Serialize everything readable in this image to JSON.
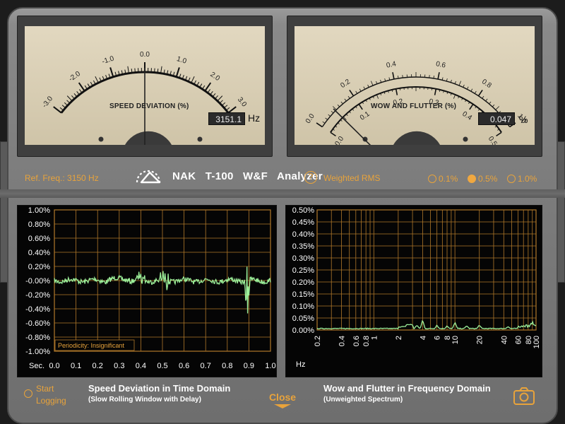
{
  "meters": {
    "speed": {
      "title": "SPEED DEVIATION (%)",
      "scale": [
        "-3.0",
        "-2.0",
        "-1.0",
        "0.0",
        "1.0",
        "2.0",
        "3.0"
      ],
      "readout": "3151.1",
      "unit": "Hz",
      "needle_value": 0.0
    },
    "wow": {
      "title": "WOW AND FLUTTER (%)",
      "outer_scale": [
        "0.0",
        "0.2",
        "0.4",
        "0.6",
        "0.8",
        "1.0"
      ],
      "inner_scale": [
        "0.0",
        "0.1",
        "0.2",
        "0.3",
        "0.4",
        "0.5"
      ],
      "readout": "0.047",
      "unit": "%",
      "needle_value": 0.047
    }
  },
  "band": {
    "ref_freq": "Ref. Freq.: 3150 Hz",
    "brand": "NAK   T-100   W&F   Analyzer",
    "help": "?",
    "weighted": "Weighted RMS",
    "ranges": [
      {
        "label": "0.1%",
        "selected": false
      },
      {
        "label": "0.5%",
        "selected": true
      },
      {
        "label": "1.0%",
        "selected": false
      }
    ]
  },
  "time_plot": {
    "y_ticks": [
      "1.00%",
      "0.80%",
      "0.60%",
      "0.40%",
      "0.20%",
      "-0.00%",
      "-0.20%",
      "-0.40%",
      "-0.60%",
      "-0.80%",
      "-1.00%"
    ],
    "x_label": "Sec.",
    "x_ticks": [
      "0.0",
      "0.1",
      "0.2",
      "0.3",
      "0.4",
      "0.5",
      "0.6",
      "0.7",
      "0.8",
      "0.9",
      "1.0"
    ],
    "periodicity": "Periodicity: Insignificant",
    "caption_title": "Speed Deviation in Time Domain",
    "caption_sub": "(Slow Rolling Window with Delay)"
  },
  "freq_plot": {
    "y_ticks": [
      "0.50%",
      "0.45%",
      "0.40%",
      "0.35%",
      "0.30%",
      "0.25%",
      "0.20%",
      "0.15%",
      "0.10%",
      "0.05%",
      "0.00%"
    ],
    "x_label": "Hz",
    "x_ticks": [
      "0.2",
      "0.4",
      "0.6",
      "0.8",
      "1",
      "2",
      "4",
      "6",
      "8",
      "10",
      "20",
      "40",
      "60",
      "80",
      "100"
    ],
    "caption_title": "Wow and Flutter in Frequency Domain",
    "caption_sub": "(Unweighted Spectrum)"
  },
  "controls": {
    "start_logging_line1": "Start",
    "start_logging_line2": "Logging",
    "close": "Close"
  },
  "colors": {
    "accent": "#e8a33b",
    "trace": "#9df09a",
    "grid": "#b0782a"
  }
}
